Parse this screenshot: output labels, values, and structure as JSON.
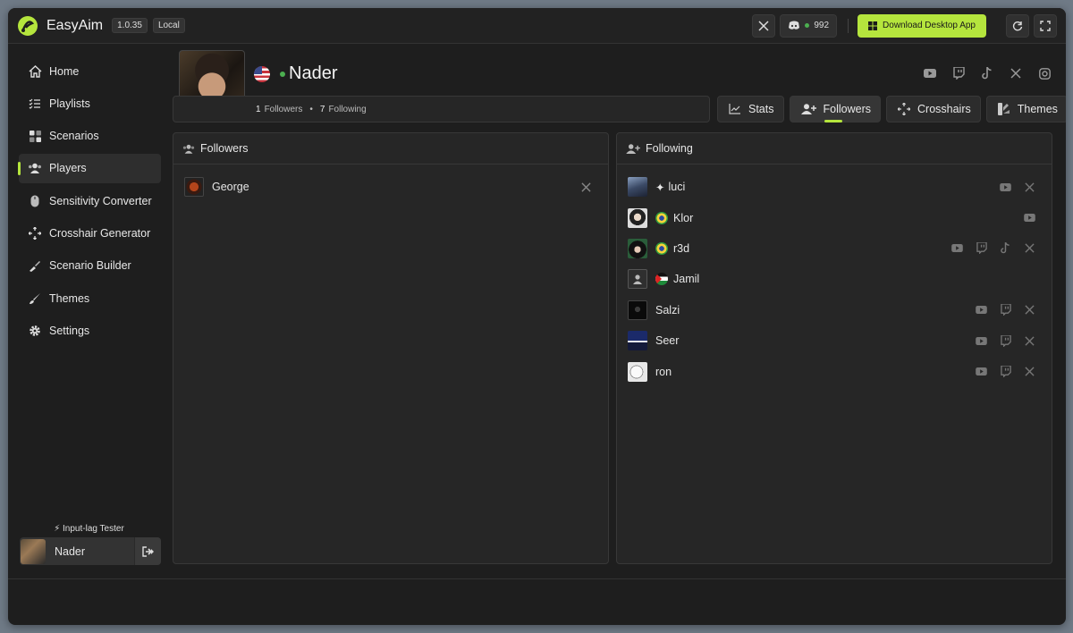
{
  "app": {
    "name": "EasyAim",
    "version": "1.0.35",
    "mode": "Local",
    "accent": "#b5e53d"
  },
  "topbar": {
    "discord_count": "992",
    "download_label": "Download Desktop App"
  },
  "sidebar": {
    "items": [
      {
        "label": "Home",
        "icon": "home-icon"
      },
      {
        "label": "Playlists",
        "icon": "playlist-icon"
      },
      {
        "label": "Scenarios",
        "icon": "scenarios-icon"
      },
      {
        "label": "Players",
        "icon": "players-icon"
      },
      {
        "label": "Sensitivity Converter",
        "icon": "mouse-icon"
      },
      {
        "label": "Crosshair Generator",
        "icon": "crosshair-icon"
      },
      {
        "label": "Scenario Builder",
        "icon": "builder-icon"
      },
      {
        "label": "Themes",
        "icon": "brush-icon"
      },
      {
        "label": "Settings",
        "icon": "gear-icon"
      }
    ],
    "active": "Players",
    "input_lag": "Input-lag Tester",
    "user": "Nader"
  },
  "profile": {
    "name": "Nader",
    "followers_count": "1",
    "followers_label": "Followers",
    "following_count": "7",
    "following_label": "Following",
    "dot_separator": "•"
  },
  "tabs": [
    {
      "label": "Stats",
      "icon": "chart-icon"
    },
    {
      "label": "Followers",
      "icon": "add-user-icon"
    },
    {
      "label": "Crosshairs",
      "icon": "crosshair-icon"
    },
    {
      "label": "Themes",
      "icon": "brush-icon"
    }
  ],
  "followers_panel": {
    "title": "Followers",
    "rows": [
      {
        "name": "George",
        "socials": [
          "x"
        ]
      }
    ]
  },
  "following_panel": {
    "title": "Following",
    "rows": [
      {
        "name": "luci",
        "prefix": "✦",
        "socials": [
          "youtube",
          "x"
        ]
      },
      {
        "name": "Klor",
        "flag": "br",
        "socials": [
          "youtube"
        ]
      },
      {
        "name": "r3d",
        "flag": "br",
        "socials": [
          "youtube",
          "twitch",
          "tiktok",
          "x"
        ]
      },
      {
        "name": "Jamil",
        "flag": "ps",
        "socials": []
      },
      {
        "name": "Salzi",
        "socials": [
          "youtube",
          "twitch",
          "x"
        ]
      },
      {
        "name": "Seer",
        "socials": [
          "youtube",
          "twitch",
          "x"
        ]
      },
      {
        "name": "ron",
        "socials": [
          "youtube",
          "twitch",
          "x"
        ]
      }
    ]
  }
}
